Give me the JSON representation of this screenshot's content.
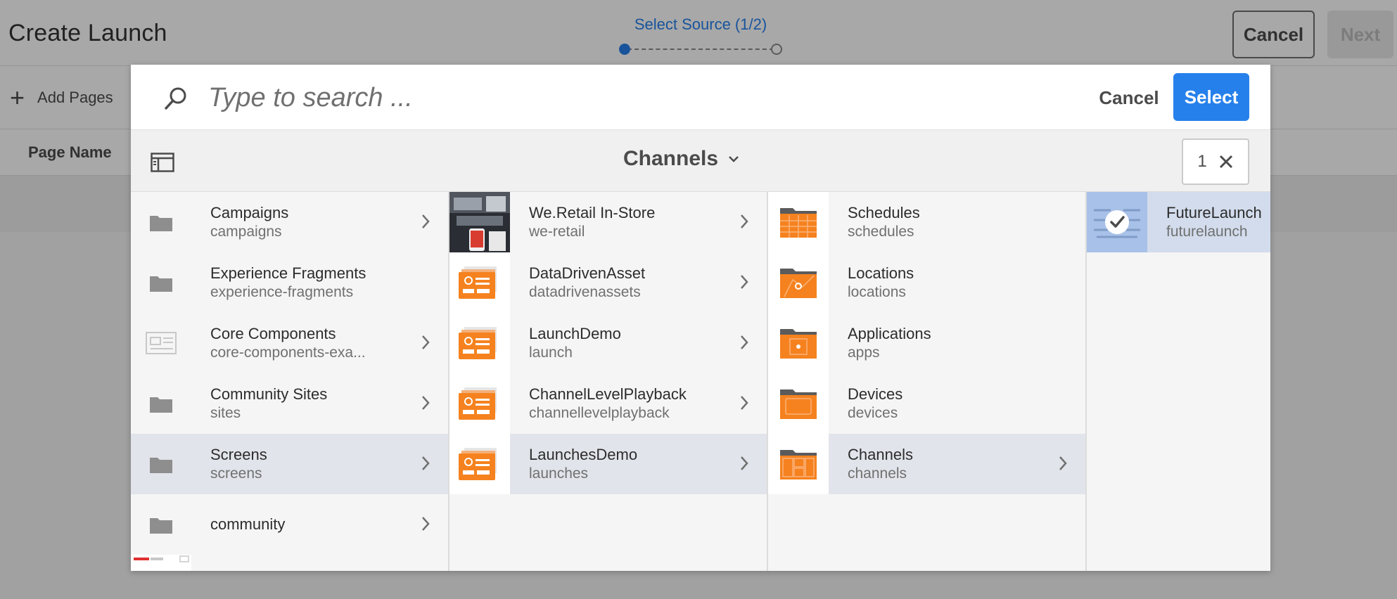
{
  "app": {
    "title": "Create Launch",
    "cancel_label": "Cancel",
    "next_label": "Next"
  },
  "wizard": {
    "step_label": "Select Source (1/2)"
  },
  "page": {
    "add_pages_label": "Add Pages",
    "column_page_name": "Page Name"
  },
  "picker": {
    "search_placeholder": "Type to search ...",
    "cancel_label": "Cancel",
    "select_label": "Select",
    "breadcrumb": "Channels",
    "selection_count": "1",
    "columns": [
      [
        {
          "title": "Campaigns",
          "subtitle": "campaigns",
          "icon": "folder-icon"
        },
        {
          "title": "Experience Fragments",
          "subtitle": "experience-fragments",
          "icon": "folder-icon"
        },
        {
          "title": "Core Components",
          "subtitle": "core-components-exa...",
          "icon": "page-template-icon"
        },
        {
          "title": "Community Sites",
          "subtitle": "sites",
          "icon": "folder-icon"
        },
        {
          "title": "Screens",
          "subtitle": "screens",
          "icon": "folder-icon"
        },
        {
          "title": "community",
          "subtitle": "",
          "icon": "folder-icon"
        },
        {
          "title": "",
          "subtitle": "",
          "icon": "we-retail-thumbnail"
        }
      ],
      [
        {
          "title": "We.Retail In-Store",
          "subtitle": "we-retail",
          "icon": "store-photo-thumbnail"
        },
        {
          "title": "DataDrivenAsset",
          "subtitle": "datadrivenassets",
          "icon": "screens-project-icon"
        },
        {
          "title": "LaunchDemo",
          "subtitle": "launch",
          "icon": "screens-project-icon"
        },
        {
          "title": "ChannelLevelPlayback",
          "subtitle": "channellevelplayback",
          "icon": "screens-project-icon"
        },
        {
          "title": "LaunchesDemo",
          "subtitle": "launches",
          "icon": "screens-project-icon"
        }
      ],
      [
        {
          "title": "Schedules",
          "subtitle": "schedules",
          "icon": "schedules-folder-icon"
        },
        {
          "title": "Locations",
          "subtitle": "locations",
          "icon": "locations-folder-icon"
        },
        {
          "title": "Applications",
          "subtitle": "apps",
          "icon": "applications-folder-icon"
        },
        {
          "title": "Devices",
          "subtitle": "devices",
          "icon": "devices-folder-icon"
        },
        {
          "title": "Channels",
          "subtitle": "channels",
          "icon": "channels-folder-icon"
        }
      ],
      [
        {
          "title": "FutureLaunch",
          "subtitle": "futurelaunch",
          "icon": "channel-checked-thumbnail"
        }
      ]
    ]
  },
  "colors": {
    "accent": "#2680eb",
    "screens_orange": "#f5821f",
    "folder_grey": "#8e8e8e"
  }
}
